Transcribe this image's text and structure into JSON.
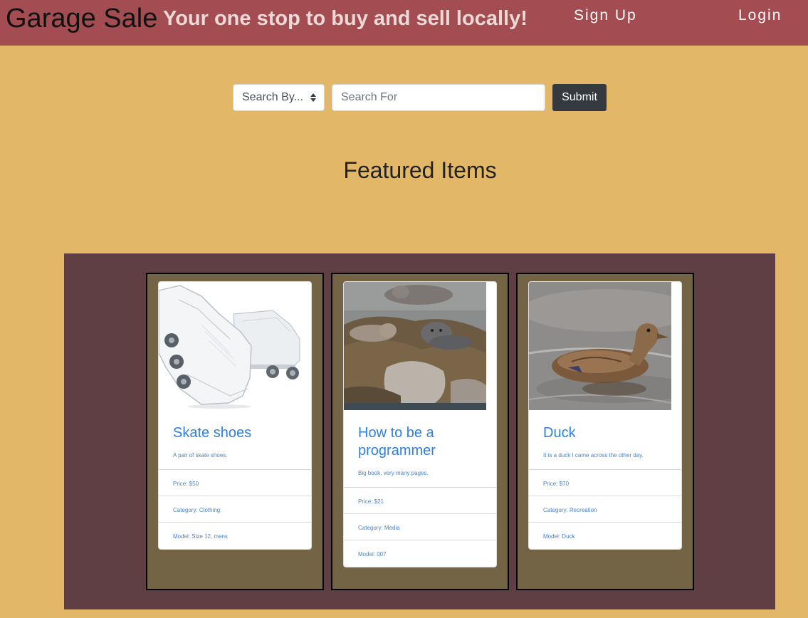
{
  "header": {
    "brand": "Garage Sale",
    "tagline": "Your one stop to buy and sell locally!",
    "signup_label": "Sign Up",
    "login_label": "Login"
  },
  "search": {
    "select_label": "Search By...",
    "input_placeholder": "Search For",
    "submit_label": "Submit"
  },
  "featured": {
    "heading": "Featured Items",
    "items": [
      {
        "title": "Skate shoes",
        "description": "A pair of skate shoes.",
        "price": "Price: $50",
        "category": "Category: Clothing",
        "model": "Model: Size 12, mens",
        "image": "skate-shoes-image"
      },
      {
        "title": "How to be a programmer",
        "description": "Big book, very many pages.",
        "price": "Price: $21",
        "category": "Category: Media",
        "model": "Model: 007",
        "image": "seals-image"
      },
      {
        "title": "Duck",
        "description": "It is a duck I came across the other day.",
        "price": "Price: $70",
        "category": "Category: Recreation",
        "model": "Model: Duck",
        "image": "duck-image"
      }
    ]
  },
  "colors": {
    "page_background": "#e2b768",
    "navbar": "#a34c51",
    "featured_panel": "#5f3f43",
    "card_slot": "#736445",
    "link_blue": "#2e7fe0",
    "button_dark": "#343a40"
  }
}
